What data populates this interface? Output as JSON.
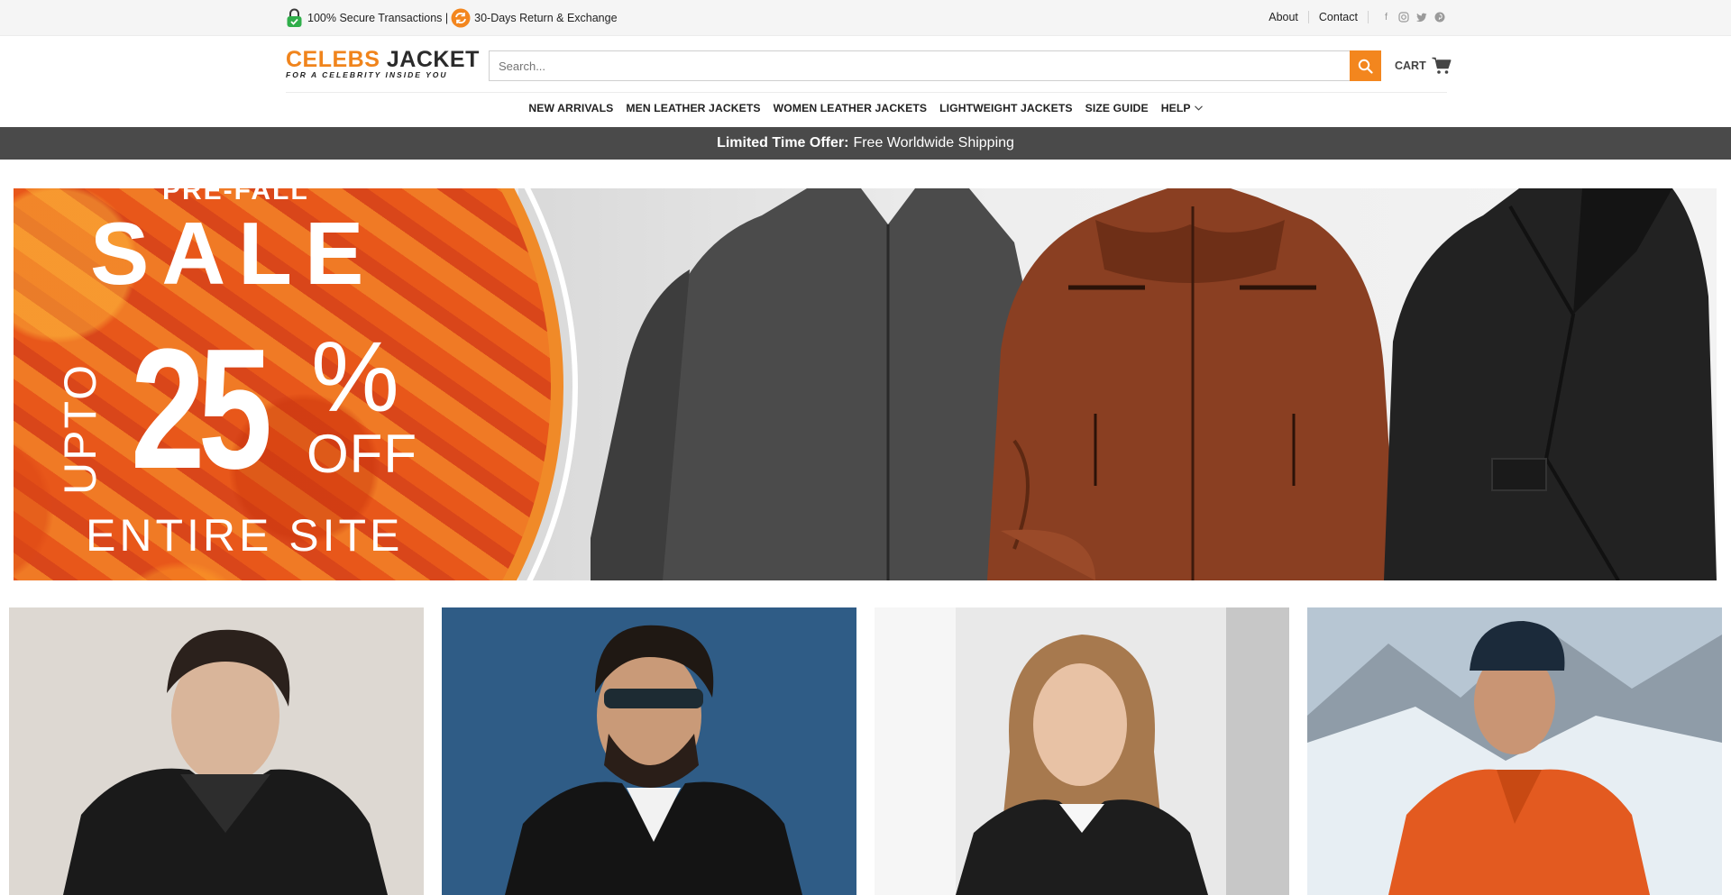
{
  "topbar": {
    "secure_text": "100% Secure Transactions |",
    "return_text": "30-Days Return & Exchange",
    "links": [
      "About",
      "Contact"
    ],
    "social_icons": [
      "facebook-icon",
      "instagram-icon",
      "twitter-icon",
      "pinterest-icon"
    ]
  },
  "header": {
    "logo_line1_a": "CELEBS",
    "logo_line1_b": "JACKET",
    "logo_line2": "FOR A CELEBRITY INSIDE YOU",
    "search_placeholder": "Search...",
    "cart_label": "CART"
  },
  "nav": {
    "items": [
      "NEW ARRIVALS",
      "MEN LEATHER JACKETS",
      "WOMEN LEATHER JACKETS",
      "LIGHTWEIGHT JACKETS",
      "SIZE GUIDE",
      "HELP"
    ]
  },
  "promo": {
    "bold": "Limited Time Offer:",
    "text": "Free Worldwide Shipping"
  },
  "hero": {
    "prefall": "PRE-FALL",
    "sale": "SALE",
    "upto": "UPTO",
    "number": "25",
    "percent": "%",
    "off": "OFF",
    "entire": "ENTIRE SITE"
  },
  "colors": {
    "accent": "#f3861e",
    "promo_bg": "#4a4a4a",
    "topbar_bg": "#f5f5f5"
  }
}
